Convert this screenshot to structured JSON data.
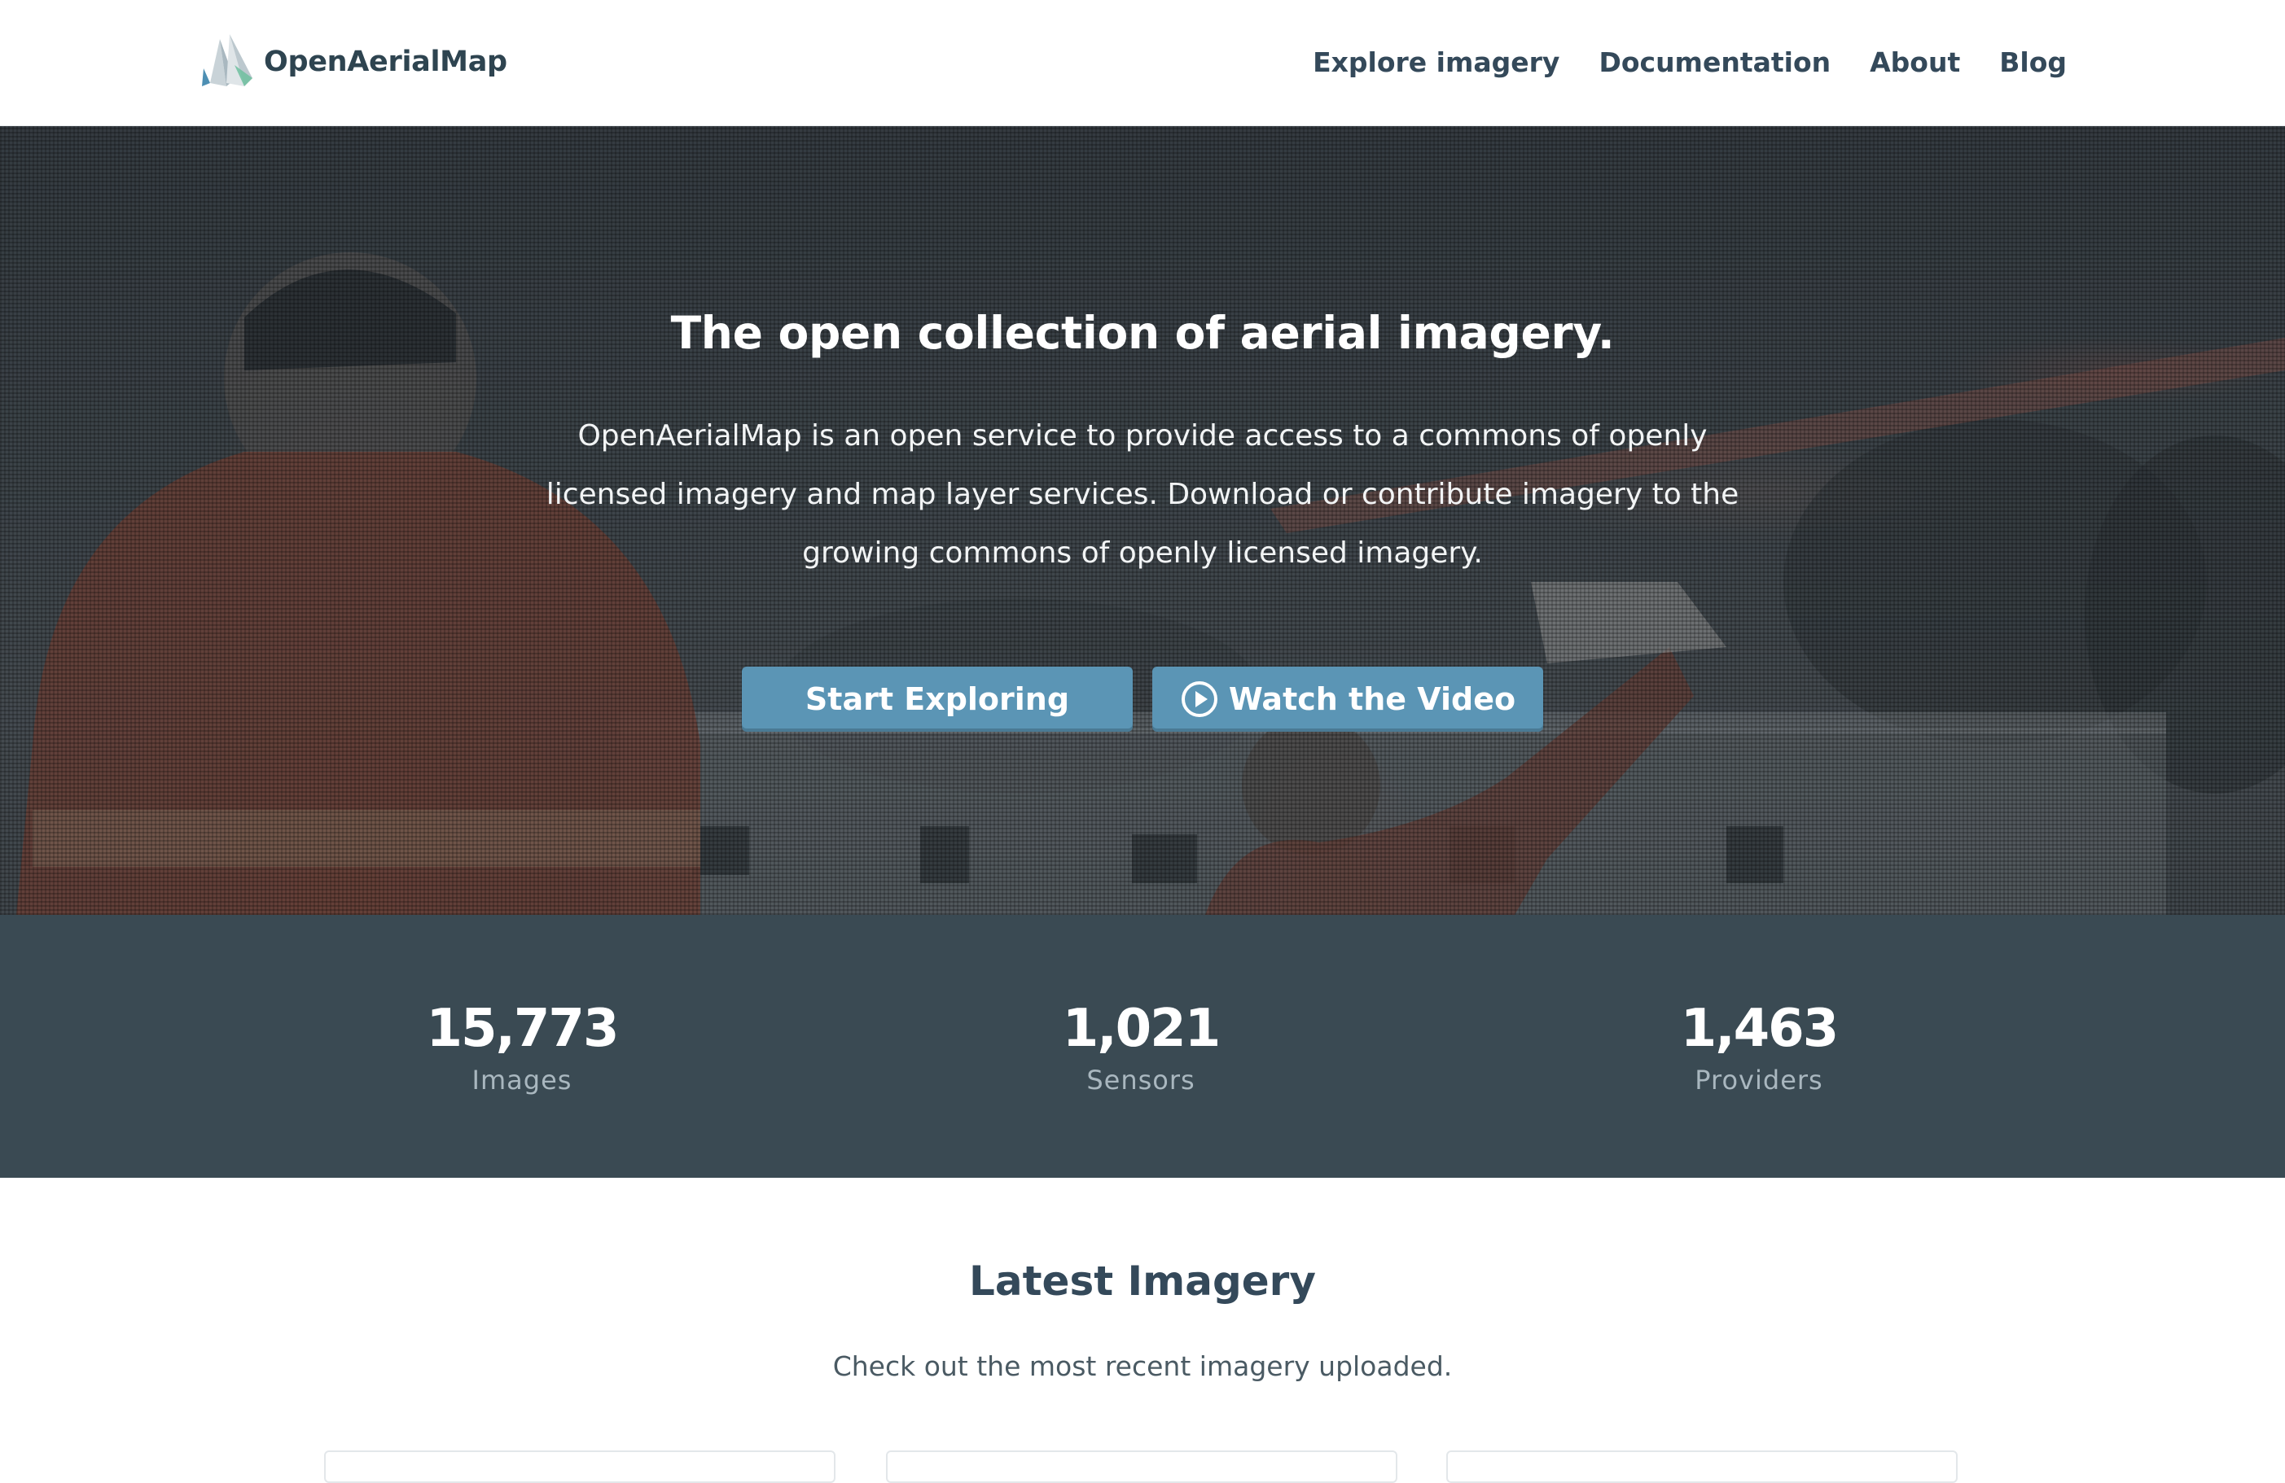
{
  "header": {
    "brand": "OpenAerialMap",
    "nav": [
      {
        "label": "Explore imagery"
      },
      {
        "label": "Documentation"
      },
      {
        "label": "About"
      },
      {
        "label": "Blog"
      }
    ]
  },
  "hero": {
    "title": "The open collection of aerial imagery.",
    "description": "OpenAerialMap is an open service to provide access to a commons of openly licensed imagery and map layer services. Download or contribute imagery to the growing commons of openly licensed imagery.",
    "buttons": {
      "start_label": "Start Exploring",
      "video_label": "Watch the Video",
      "video_icon": "play-circle-icon"
    }
  },
  "stats": [
    {
      "value": "15,773",
      "label": "Images"
    },
    {
      "value": "1,021",
      "label": "Sensors"
    },
    {
      "value": "1,463",
      "label": "Providers"
    }
  ],
  "latest": {
    "title": "Latest Imagery",
    "subtitle": "Check out the most recent imagery uploaded."
  },
  "colors": {
    "brand_text": "#2e4450",
    "button": "#5b95b5",
    "stats_background": "#3a4a53",
    "stat_label": "#a9b7bf"
  }
}
